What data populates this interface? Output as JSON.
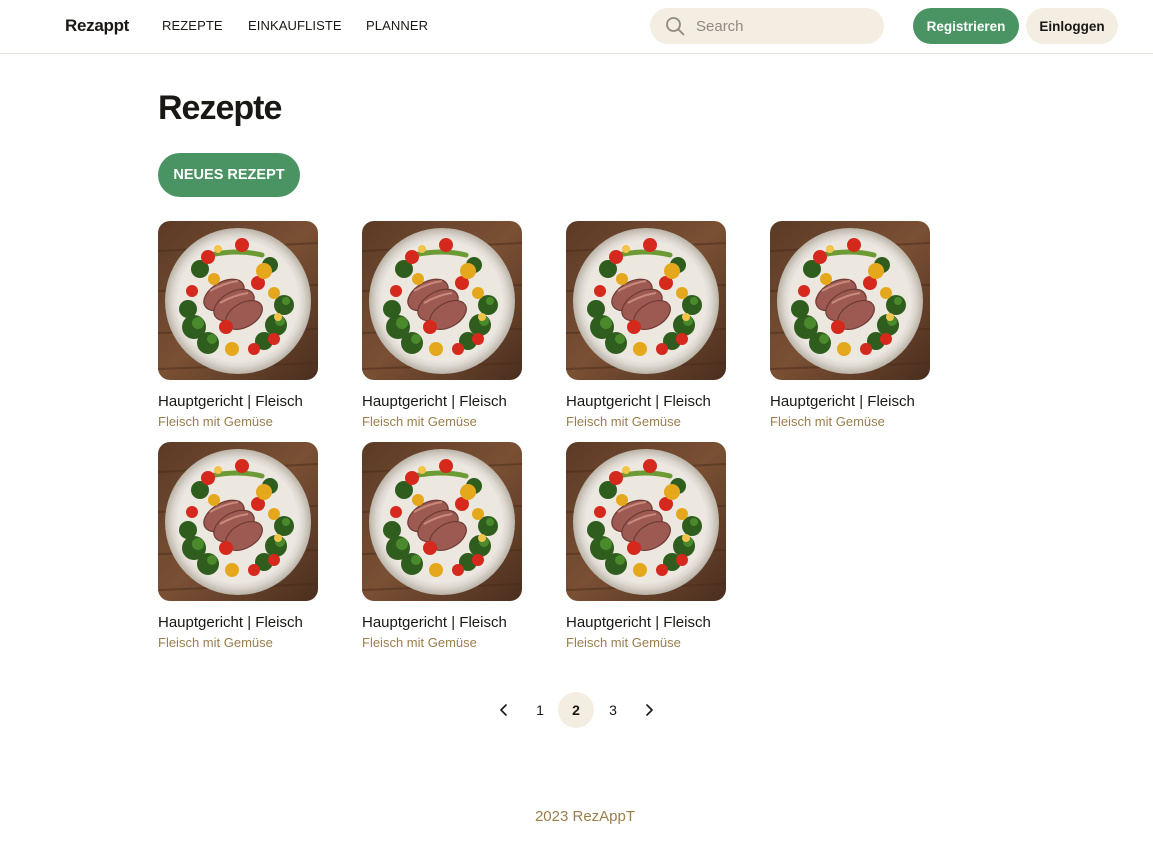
{
  "header": {
    "brand": "Rezappt",
    "nav": [
      {
        "label": "REZEPTE"
      },
      {
        "label": "EINKAUFLISTE"
      },
      {
        "label": "PLANNER"
      }
    ],
    "search": {
      "placeholder": "Search",
      "value": ""
    },
    "register_label": "Registrieren",
    "login_label": "Einloggen"
  },
  "main": {
    "title": "Rezepte",
    "new_recipe_label": "NEUES REZEPT",
    "recipes": [
      {
        "title": "Hauptgericht | Fleisch",
        "subtitle": "Fleisch mit Gemüse"
      },
      {
        "title": "Hauptgericht | Fleisch",
        "subtitle": "Fleisch mit Gemüse"
      },
      {
        "title": "Hauptgericht | Fleisch",
        "subtitle": "Fleisch mit Gemüse"
      },
      {
        "title": "Hauptgericht | Fleisch",
        "subtitle": "Fleisch mit Gemüse"
      },
      {
        "title": "Hauptgericht | Fleisch",
        "subtitle": "Fleisch mit Gemüse"
      },
      {
        "title": "Hauptgericht | Fleisch",
        "subtitle": "Fleisch mit Gemüse"
      },
      {
        "title": "Hauptgericht | Fleisch",
        "subtitle": "Fleisch mit Gemüse"
      }
    ]
  },
  "pagination": {
    "pages": [
      "1",
      "2",
      "3"
    ],
    "current": "2"
  },
  "footer": {
    "text": "2023 RezAppT"
  },
  "colors": {
    "accent_green": "#4a9464",
    "beige": "#f3ede2",
    "muted_brown": "#9a7e4c"
  },
  "icons": {
    "search": "search-icon",
    "prev": "chevron-left-icon",
    "next": "chevron-right-icon"
  }
}
